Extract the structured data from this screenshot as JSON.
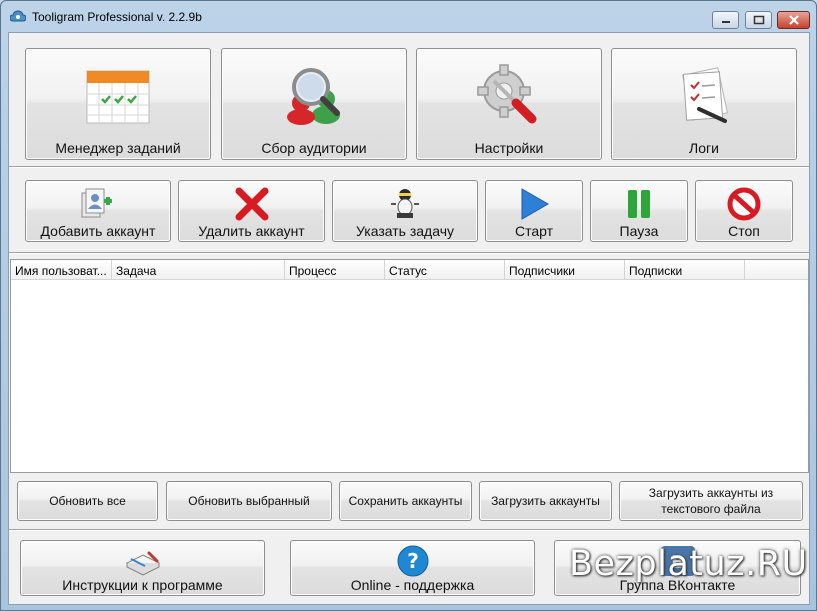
{
  "window": {
    "title": "Tooligram Professional v. 2.2.9b"
  },
  "top_buttons": [
    {
      "label": "Менеджер заданий",
      "icon": "calendar-icon"
    },
    {
      "label": "Сбор аудитории",
      "icon": "magnifier-users-icon"
    },
    {
      "label": "Настройки",
      "icon": "gear-screwdriver-icon"
    },
    {
      "label": "Логи",
      "icon": "checklist-pen-icon"
    }
  ],
  "account_buttons": [
    {
      "label": "Добавить аккаунт",
      "icon": "add-account-icon"
    },
    {
      "label": "Удалить аккаунт",
      "icon": "red-x-icon"
    },
    {
      "label": "Указать задачу",
      "icon": "robot-icon"
    },
    {
      "label": "Старт",
      "icon": "play-icon"
    },
    {
      "label": "Пауза",
      "icon": "pause-icon"
    },
    {
      "label": "Стоп",
      "icon": "stop-icon"
    }
  ],
  "table": {
    "columns": [
      "Имя пользоват...",
      "Задача",
      "Процесс",
      "Статус",
      "Подписчики",
      "Подписки"
    ],
    "rows": []
  },
  "list_buttons": {
    "refresh_all": "Обновить все",
    "refresh_selected": "Обновить выбранный",
    "save_accounts": "Сохранить аккаунты",
    "load_accounts": "Загрузить аккаунты",
    "load_from_file_line1": "Загрузить аккаунты из",
    "load_from_file_line2": "текстового файла"
  },
  "bottom_buttons": [
    {
      "label": "Инструкции к программе",
      "icon": "book-icon"
    },
    {
      "label": "Online - поддержка",
      "icon": "help-icon"
    },
    {
      "label": "Группа ВКонтакте",
      "icon": "vk-icon"
    }
  ],
  "watermark": "Bezplatuz.RU",
  "colors": {
    "stop_red": "#d81b22",
    "play_blue": "#2e7fd8",
    "pause_green": "#2ea53a",
    "help_blue": "#1e88d2"
  }
}
